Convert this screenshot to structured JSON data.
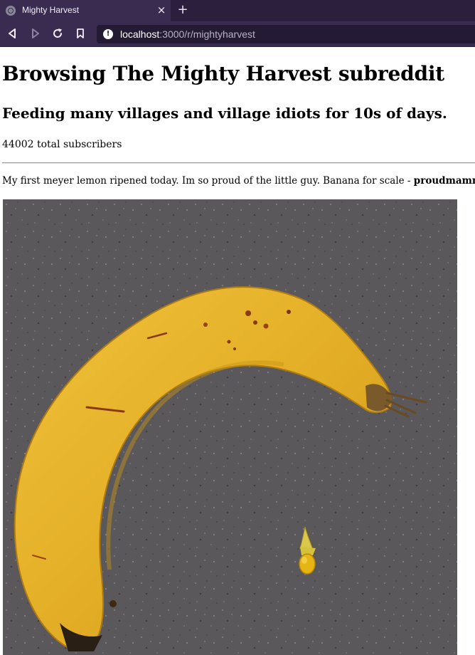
{
  "browser": {
    "tab_title": "Mighty Harvest",
    "close_glyph": "×",
    "new_tab_glyph": "+",
    "url_host": "localhost",
    "url_rest": ":3000/r/mightyharvest",
    "icons": {
      "favicon": "globe-icon",
      "close": "close-icon",
      "new_tab": "plus-icon",
      "back": "back-icon",
      "forward": "forward-icon",
      "reload": "reload-icon",
      "bookmark": "bookmark-icon",
      "site_info": "info-icon"
    }
  },
  "page": {
    "title": "Browsing The Mighty Harvest subreddit",
    "tagline": "Feeding many villages and village idiots for 10s of days.",
    "subscribers": "44002 total subscribers",
    "post": {
      "text": "My first meyer lemon ripened today. Im so proud of the little guy. Banana for scale - ",
      "author": "proudmamma",
      "image_subject": "banana next to a tiny lemon on a grey countertop"
    }
  },
  "colors": {
    "tab_bar": "#2b1f3d",
    "toolbar": "#3a2c51",
    "url_field": "#241a33",
    "banana": "#e8b52a",
    "countertop": "#5b585c",
    "lemon": "#e6b514"
  }
}
